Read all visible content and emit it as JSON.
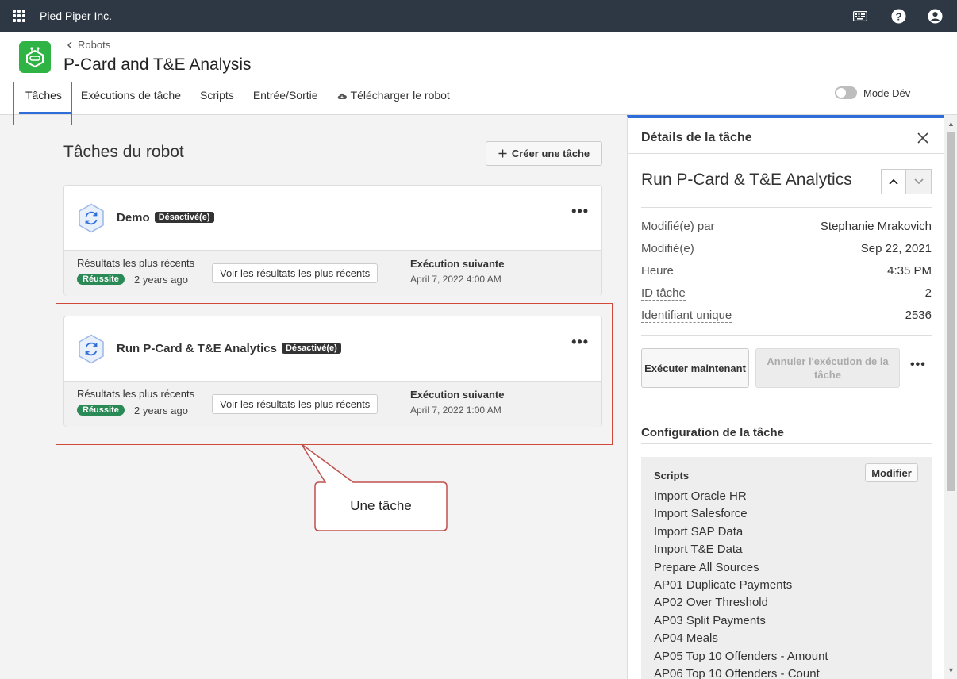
{
  "topbar": {
    "org_name": "Pied Piper Inc.",
    "icons": [
      "apps-grid-icon",
      "keyboard-icon",
      "help-icon",
      "user-icon"
    ]
  },
  "header": {
    "breadcrumb": "Robots",
    "title": "P-Card and T&E Analysis",
    "tabs": [
      {
        "label": "Tâches",
        "active": true
      },
      {
        "label": "Exécutions de tâche"
      },
      {
        "label": "Scripts"
      },
      {
        "label": "Entrée/Sortie"
      },
      {
        "label": "Télécharger le robot",
        "icon": "cloud-download-icon"
      }
    ],
    "mode_dev_label": "Mode Dév",
    "mode_dev_on": false
  },
  "main": {
    "section_title": "Tâches du robot",
    "create_button": "Créer une tâche",
    "tasks": [
      {
        "name": "Demo",
        "status": "Désactivé(e)",
        "results_label": "Résultats les plus récents",
        "result_status": "Réussite",
        "result_ago": "2 years ago",
        "results_button": "Voir les résultats les plus récents",
        "next_label": "Exécution suivante",
        "next_date": "April 7, 2022 4:00 AM"
      },
      {
        "name": "Run P-Card & T&E Analytics",
        "status": "Désactivé(e)",
        "results_label": "Résultats les plus récents",
        "result_status": "Réussite",
        "result_ago": "2 years ago",
        "results_button": "Voir les résultats les plus récents",
        "next_label": "Exécution suivante",
        "next_date": "April 7, 2022 1:00 AM"
      }
    ],
    "callout": "Une tâche"
  },
  "panel": {
    "title": "Détails de la tâche",
    "task_name": "Run P-Card & T&E Analytics",
    "details": [
      {
        "key": "Modifié(e) par",
        "value": "Stephanie Mrakovich"
      },
      {
        "key": "Modifié(e)",
        "value": "Sep 22, 2021"
      },
      {
        "key": "Heure",
        "value": "4:35 PM"
      },
      {
        "key": "ID tâche",
        "value": "2"
      },
      {
        "key": "Identifiant unique",
        "value": "2536"
      }
    ],
    "run_button": "Exécuter maintenant",
    "cancel_button": "Annuler l'exécution de la tâche",
    "config_title": "Configuration de la tâche",
    "scripts_label": "Scripts",
    "modify_button": "Modifier",
    "scripts": [
      "Import Oracle HR",
      "Import Salesforce",
      "Import SAP Data",
      "Import T&E Data",
      "Prepare All Sources",
      "AP01 Duplicate Payments",
      "AP02 Over Threshold",
      "AP03 Split Payments",
      "AP04 Meals",
      "AP05 Top 10 Offenders - Amount",
      "AP06 Top 10 Offenders - Count"
    ]
  },
  "colors": {
    "topbar": "#2e3845",
    "accent": "#2f6ed8",
    "success": "#2a8a55",
    "highlight": "#d04a3a",
    "robot_logo": "#2fb344"
  }
}
